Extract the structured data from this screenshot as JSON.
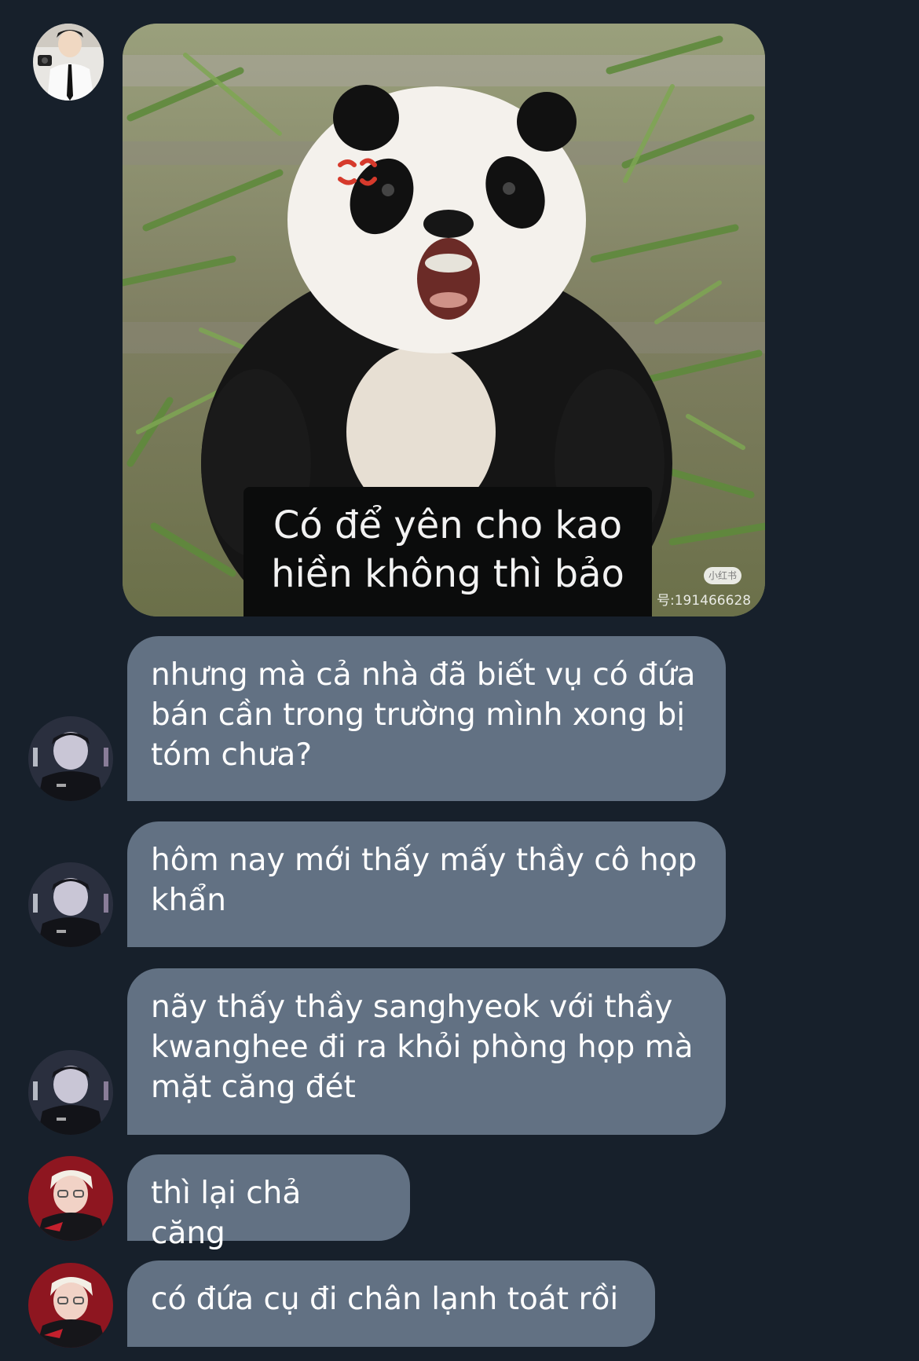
{
  "thread": {
    "image_message": {
      "caption": "Có để yên cho kao\nhiền không thì bảo",
      "watermark_logo": "小红书",
      "watermark_id": "号:191466628",
      "anger_mark_color": "#d63a2c"
    },
    "messages": [
      {
        "text": "nhưng mà cả nhà đã biết vụ có đứa\nbán cần trong trường mình xong bị\ntóm chưa?"
      },
      {
        "text": "hôm nay mới thấy mấy thầy cô họp\nkhẩn"
      },
      {
        "text": "nãy thấy thầy sanghyeok với thầy\nkwanghee đi ra khỏi phòng họp mà\nmặt căng đét"
      },
      {
        "text": "thì lại chả căng"
      },
      {
        "text": "có đứa cụ đi chân lạnh toát rồi"
      }
    ]
  },
  "colors": {
    "background": "#17202b",
    "bubble": "#627183",
    "bubble_text": "#ffffff"
  }
}
